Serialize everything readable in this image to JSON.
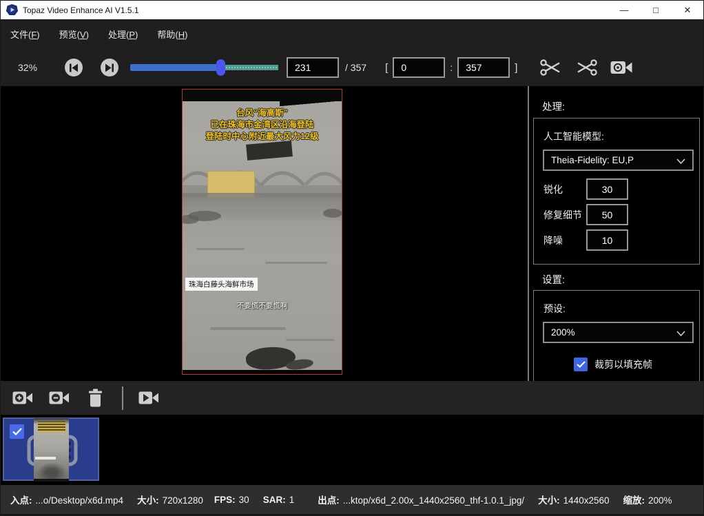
{
  "colors": {
    "accent_blue": "#3f66e0",
    "slider_fill_blue": "#3d6fd0",
    "slider_track_teal": "#4f9b94",
    "slider_thumb_blue": "#4c55ee",
    "selection_blue": "#2a3c8c",
    "video_border_red": "#a93c2e",
    "titlebar_bg": "#ffffff",
    "chrome_bg": "#1f1f1f"
  },
  "icons": {
    "logo": "play-shield-icon",
    "skip_start": "skip-to-start-icon",
    "skip_end": "skip-to-end-icon",
    "trim_in": "scissors-right-icon",
    "trim_out": "scissors-left-icon",
    "preview": "camera-eye-icon",
    "add_video": "camera-plus-icon",
    "remove_video": "camera-minus-icon",
    "delete": "trash-icon",
    "process_video": "camera-play-icon",
    "checked": "checkmark-icon",
    "dropdown": "chevron-down-icon"
  },
  "titlebar": {
    "title": "Topaz Video Enhance AI V1.5.1",
    "minimize": "—",
    "maximize": "□",
    "close": "✕"
  },
  "menu": {
    "items": [
      {
        "pre": "文件(",
        "key": "F",
        "post": ")"
      },
      {
        "pre": "预览(",
        "key": "V",
        "post": ")"
      },
      {
        "pre": "处理(",
        "key": "P",
        "post": ")"
      },
      {
        "pre": "帮助(",
        "key": "H",
        "post": ")"
      }
    ]
  },
  "toolbar": {
    "zoom_level": "32%",
    "current_frame": "231",
    "total_frames": "/ 357",
    "bracket_open": "[",
    "trim_start": "0",
    "separator": ":",
    "trim_end": "357",
    "bracket_close": "]"
  },
  "video": {
    "overlay_title_line1": "台风“海高斯”",
    "overlay_title_line2": "已在珠海市金湾区沿海登陆",
    "overlay_title_line3": "登陆时中心附近最大风力12级",
    "location_label": "珠海白藤头海鲜市场",
    "subtitle": "不要慌不要慌啊"
  },
  "panel": {
    "process_heading": "处理:",
    "ai_model_label": "人工智能模型:",
    "ai_model_value": "Theia-Fidelity: EU,P",
    "params": [
      {
        "label": "锐化",
        "value": "30"
      },
      {
        "label": "修复细节",
        "value": "50"
      },
      {
        "label": "降噪",
        "value": "10"
      }
    ],
    "settings_heading": "设置:",
    "preset_label": "预设:",
    "preset_value": "200%",
    "crop_label": "裁剪以填充帧",
    "crop_checked": true
  },
  "statusbar": {
    "items": [
      {
        "label": "入点:",
        "value": "...o/Desktop/x6d.mp4"
      },
      {
        "label": "大小:",
        "value": "720x1280"
      },
      {
        "label": "FPS:",
        "value": "30"
      },
      {
        "label": "SAR:",
        "value": "1"
      },
      {
        "label": "出点:",
        "value": "...ktop/x6d_2.00x_1440x2560_thf-1.0.1_jpg/"
      },
      {
        "label": "大小:",
        "value": "1440x2560"
      },
      {
        "label": "缩放:",
        "value": "200%"
      }
    ]
  }
}
